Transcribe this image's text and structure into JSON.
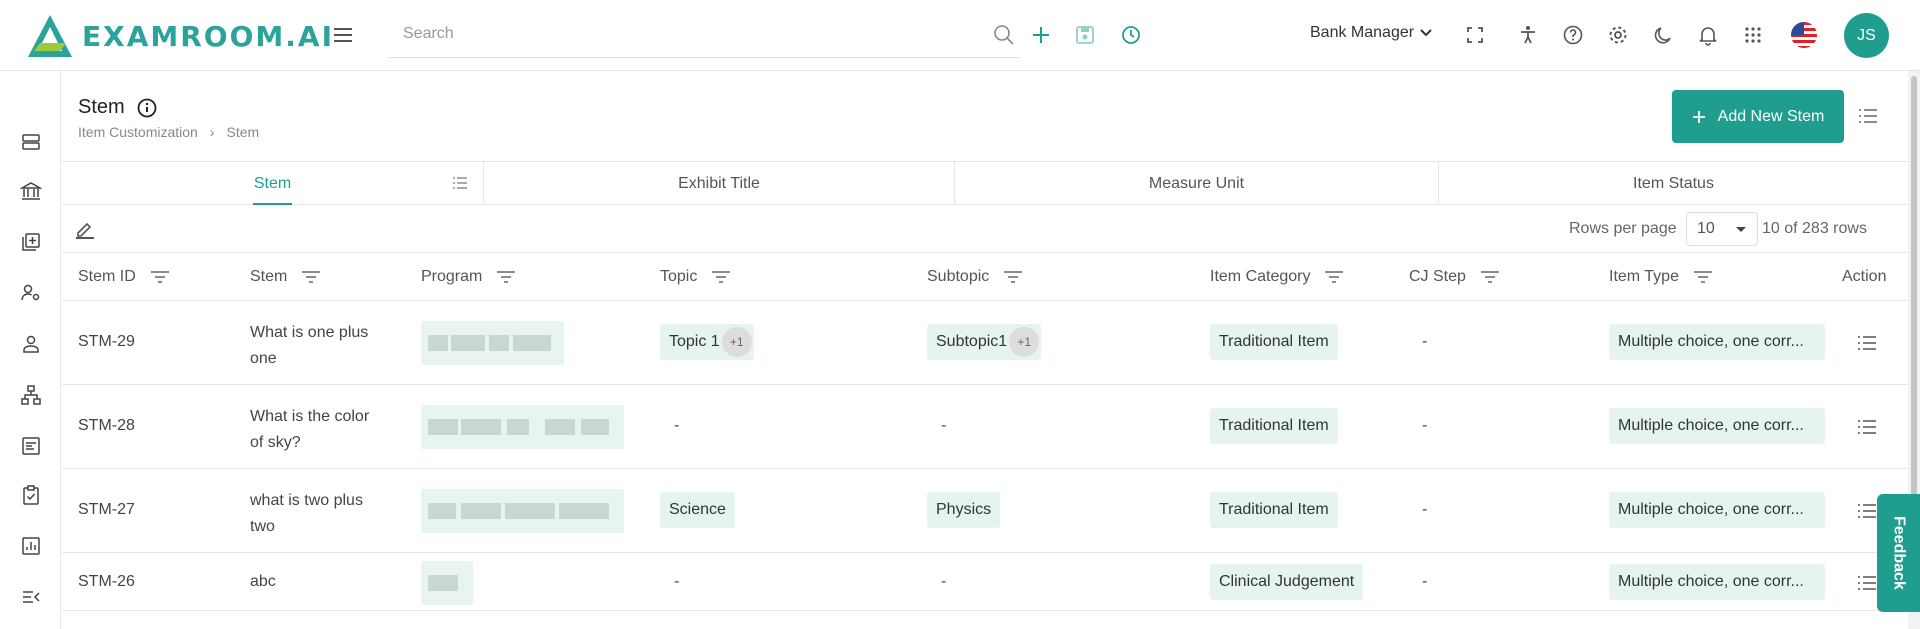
{
  "header": {
    "logo_text": "EXAMROOM.AI",
    "search_placeholder": "Search",
    "role": "Bank Manager",
    "avatar_initials": "JS"
  },
  "colors": {
    "accent": "#1f9e8f",
    "chip_bg": "#e6f4f1"
  },
  "page": {
    "title": "Stem",
    "breadcrumb": [
      "Item Customization",
      "Stem"
    ],
    "add_button": "Add New Stem"
  },
  "tabs": [
    "Stem",
    "Exhibit Title",
    "Measure Unit",
    "Item Status"
  ],
  "pagination": {
    "rows_label": "Rows per page",
    "rows_value": "10",
    "count_text": "10 of 283 rows"
  },
  "columns": [
    "Stem ID",
    "Stem",
    "Program",
    "Topic",
    "Subtopic",
    "Item Category",
    "CJ Step",
    "Item Type",
    "Action"
  ],
  "rows": [
    {
      "id": "STM-29",
      "stem_l1": "What is one plus",
      "stem_l2": "one",
      "topic": "Topic 1",
      "topic_more": "+1",
      "subtopic": "Subtopic1",
      "subtopic_more": "+1",
      "category": "Traditional Item",
      "cj_step": "-",
      "item_type": "Multiple choice, one corr..."
    },
    {
      "id": "STM-28",
      "stem_l1": "What is the color",
      "stem_l2": "of sky?",
      "topic": "-",
      "subtopic": "-",
      "category": "Traditional Item",
      "cj_step": "-",
      "item_type": "Multiple choice, one corr..."
    },
    {
      "id": "STM-27",
      "stem_l1": "what is two plus",
      "stem_l2": "two",
      "topic": "Science",
      "subtopic": "Physics",
      "category": "Traditional Item",
      "cj_step": "-",
      "item_type": "Multiple choice, one corr..."
    },
    {
      "id": "STM-26",
      "stem_l1": "abc",
      "stem_l2": "",
      "topic": "-",
      "subtopic": "-",
      "category": "Clinical Judgement",
      "cj_step": "-",
      "item_type": "Multiple choice, one corr..."
    }
  ],
  "feedback_label": "Feedback",
  "icons": [
    "logo-icon",
    "menu-icon",
    "search-icon",
    "plus-icon",
    "save-icon",
    "history-icon",
    "chevron-down-icon",
    "fullscreen-icon",
    "accessibility-icon",
    "help-icon",
    "gear-icon",
    "moon-icon",
    "bell-icon",
    "apps-grid-icon",
    "us-flag-icon",
    "info-icon",
    "filter-icon",
    "list-icon",
    "edit-icon"
  ]
}
